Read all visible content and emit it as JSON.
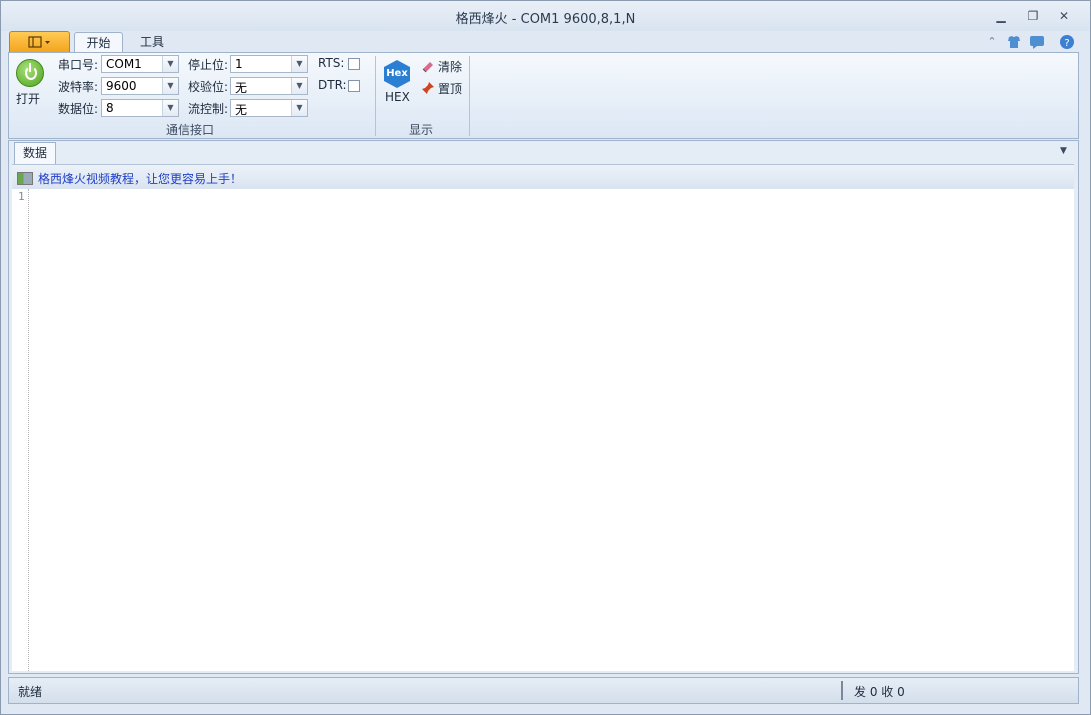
{
  "window": {
    "title": "格西烽火 - COM1  9600,8,1,N",
    "controls": [
      "▁",
      "❐",
      "✕"
    ]
  },
  "ribbon": {
    "tabs": [
      "开始",
      "工具"
    ],
    "open_label": "打开",
    "fields": {
      "port_label": "串口号:",
      "port_value": "COM1",
      "baud_label": "波特率:",
      "baud_value": "9600",
      "databits_label": "数据位:",
      "databits_value": "8",
      "stopbits_label": "停止位:",
      "stopbits_value": "1",
      "parity_label": "校验位:",
      "parity_value": "无",
      "flow_label": "流控制:",
      "flow_value": "无",
      "rts_label": "RTS:",
      "dtr_label": "DTR:"
    },
    "group1_label": "通信接口",
    "hex_icon_text": "Hex",
    "hex_label": "HEX",
    "clear_label": "清除",
    "top_label": "置顶",
    "group2_label": "显示"
  },
  "doc": {
    "tab_label": "数据",
    "banner_text": "格西烽火视频教程，让您更容易上手！",
    "line_number": "1"
  },
  "status": {
    "left": "就绪",
    "right": "发 0  收 0"
  }
}
